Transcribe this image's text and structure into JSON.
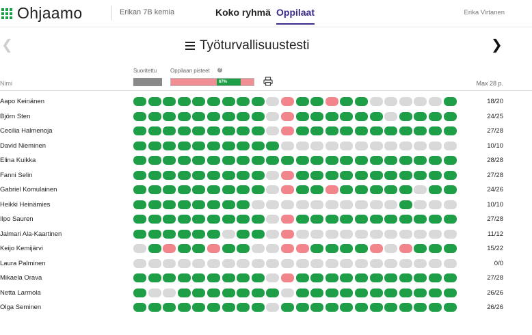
{
  "header": {
    "logo_text": "Ohjaamo",
    "class_name": "Erikan 7B kemia",
    "nav": [
      {
        "label": "Koko ryhmä",
        "active": false
      },
      {
        "label": "Oppilaat",
        "active": true
      }
    ],
    "user_name": "Erika Virtanen",
    "colors": {
      "brand_green": "#1f9a49",
      "nav_active": "#3a2a8a"
    }
  },
  "test": {
    "prev_icon": "chevron-left-icon",
    "next_icon": "chevron-right-icon",
    "title_icon": "list-icon",
    "title": "Työturvallisuustesti"
  },
  "columns": {
    "name": "Nimi",
    "completed": "Suoritettu",
    "student_score": "Oppilaan pisteet",
    "info_icon": "info-icon",
    "score_percent_label": "67%",
    "score_percent": 0.67,
    "printer_icon": "printer-icon",
    "max_points": "Max 28 p."
  },
  "legend_colors": {
    "correct": "#1e9e46",
    "unanswered": "#d9d9d9",
    "wrong": "#f2848c",
    "completed": "#8a8a8a"
  },
  "students": [
    {
      "name": "Aapo Keinänen",
      "score": "18/20",
      "answers": "gggggggggxrggrggxxxxxg"
    },
    {
      "name": "Björn Sten",
      "score": "24/25",
      "answers": "gggggggggxrggggggxgggg"
    },
    {
      "name": "Cecilia Halmenoja",
      "score": "27/28",
      "answers": "gggggggggxrggggggggggg"
    },
    {
      "name": "David Nieminen",
      "score": "10/10",
      "answers": "ggggggggggxxxxxxxxxxxx"
    },
    {
      "name": "Elina Kuikka",
      "score": "28/28",
      "answers": "gggggggggggggggggggggg"
    },
    {
      "name": "Fanni Selin",
      "score": "27/28",
      "answers": "gggggggggxrggggggggggg"
    },
    {
      "name": "Gabriel Komulainen",
      "score": "24/26",
      "answers": "gggggggggxrggrgggggxgg"
    },
    {
      "name": "Heikki Heinämies",
      "score": "10/10",
      "answers": "ggggggggxxxxxxxxxxgxxx"
    },
    {
      "name": "Ilpo Sauren",
      "score": "27/28",
      "answers": "gggggggggxrggggggggggg"
    },
    {
      "name": "Jalmari Ala-Kaartinen",
      "score": "11/12",
      "answers": "ggggggxggxrxxxxxxxxxxx"
    },
    {
      "name": "Keijo Kemijärvi",
      "score": "15/22",
      "answers": "xgrggrggxxrrggggrxrggg"
    },
    {
      "name": "Laura Palminen",
      "score": "0/0",
      "answers": "xxxxxxxxxxxxxxxxxxxxxx"
    },
    {
      "name": "Mikaela Orava",
      "score": "27/28",
      "answers": "gggggggggxrggggggggggg"
    },
    {
      "name": "Netta Larmola",
      "score": "26/26",
      "answers": "gxxgggggggxggggggggggg"
    },
    {
      "name": "Olga Seminen",
      "score": "26/26",
      "answers": "gggggggggxgggggggggggg"
    }
  ]
}
